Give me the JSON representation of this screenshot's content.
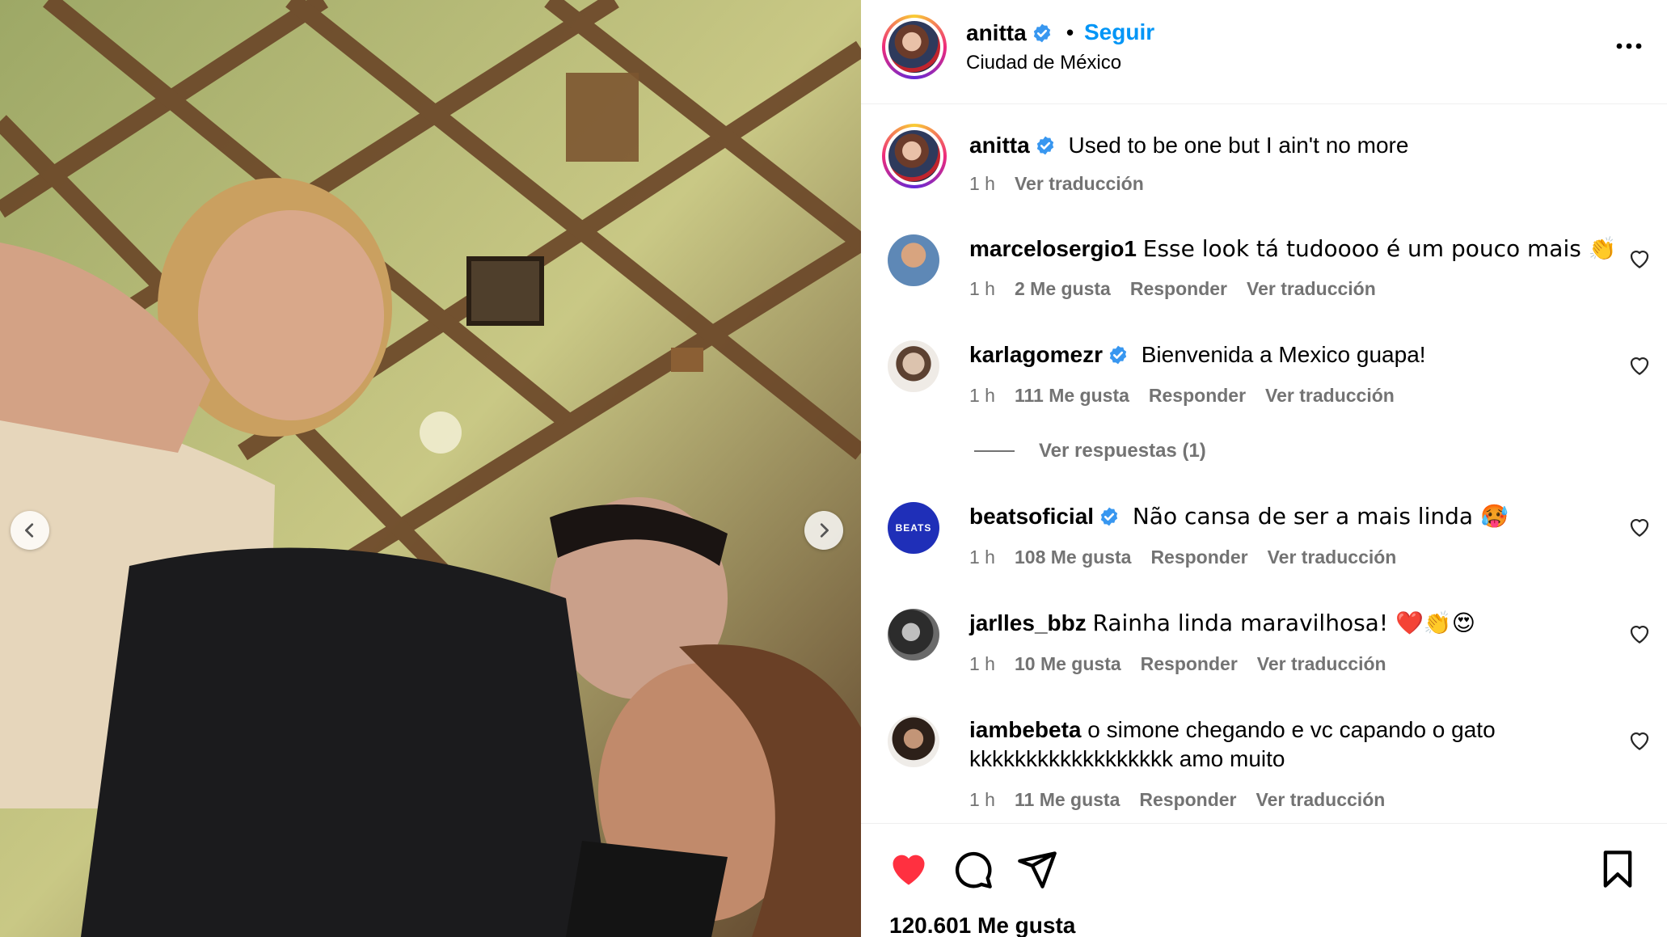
{
  "post": {
    "username": "anitta",
    "follow_label": "Seguir",
    "separator": "•",
    "location": "Ciudad de México",
    "caption": "Used to be one but I ain't no more",
    "caption_time": "1 h",
    "translate_label": "Ver traducción",
    "likes_label": "120.601 Me gusta",
    "liked": true
  },
  "comments": [
    {
      "username": "marcelosergio1",
      "verified": false,
      "text": "Esse look tá tudoooo é um pouco mais 👏",
      "time": "1 h",
      "likes": "2 Me gusta",
      "reply": "Responder",
      "translate": "Ver traducción",
      "avatar_color": "#4f6e8f"
    },
    {
      "username": "karlagomezr",
      "verified": true,
      "text": "Bienvenida a Mexico guapa!",
      "time": "1 h",
      "likes": "111 Me gusta",
      "reply": "Responder",
      "translate": "Ver traducción",
      "avatar_color": "#c9bdb2"
    },
    {
      "username": "beatsoficial",
      "verified": true,
      "text": "Não cansa de ser a mais linda 🥵",
      "time": "1 h",
      "likes": "108 Me gusta",
      "reply": "Responder",
      "translate": "Ver traducción",
      "avatar_color": "#1f2fb8",
      "avatar_text": "BEATS"
    },
    {
      "username": "jarlles_bbz",
      "verified": false,
      "text": "Rainha linda maravilhosa! ❤️👏😍",
      "time": "1 h",
      "likes": "10 Me gusta",
      "reply": "Responder",
      "translate": "Ver traducción",
      "avatar_color": "#3a3a3a"
    },
    {
      "username": "iambebeta",
      "verified": false,
      "text": "o simone chegando e vc capando o gato",
      "text2": "kkkkkkkkkkkkkkkkkk amo muito",
      "time": "1 h",
      "likes": "11 Me gusta",
      "reply": "Responder",
      "translate": "Ver traducción",
      "avatar_color": "#6a5a4f"
    }
  ],
  "replies_label": "Ver respuestas (1)",
  "icons": {
    "prev": "chevron-left-icon",
    "next": "chevron-right-icon",
    "verified": "verified-badge-icon",
    "more": "more-horizontal-icon",
    "heart": "heart-icon",
    "comment": "comment-icon",
    "share": "share-icon",
    "save": "bookmark-icon"
  },
  "colors": {
    "accent": "#0095f6",
    "like": "#ff3040",
    "muted": "#737373"
  }
}
